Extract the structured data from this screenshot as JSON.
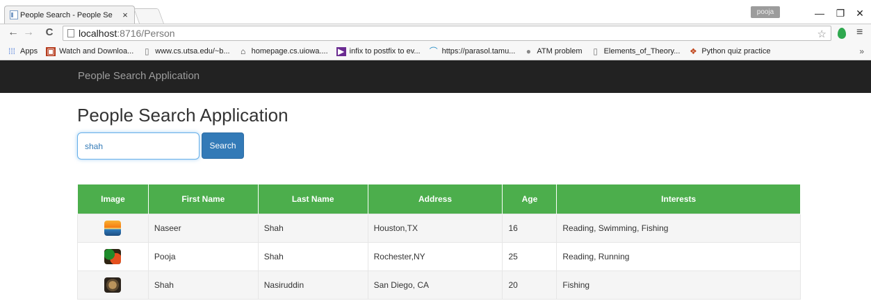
{
  "browser": {
    "tab_title": "People Search - People Se",
    "tab_close": "×",
    "profile": "pooja",
    "url_host": "localhost",
    "url_path": ":8716/Person",
    "bookmarks": [
      {
        "label": "Apps",
        "icon": "apps-grid-icon"
      },
      {
        "label": "Watch and Downloa...",
        "icon": "movie-icon"
      },
      {
        "label": "www.cs.utsa.edu/~b...",
        "icon": "page-icon"
      },
      {
        "label": "homepage.cs.uiowa....",
        "icon": "building-icon"
      },
      {
        "label": "infix to postfix to ev...",
        "icon": "visual-studio-icon"
      },
      {
        "label": "https://parasol.tamu...",
        "icon": "arc-icon"
      },
      {
        "label": "ATM problem",
        "icon": "globe-icon"
      },
      {
        "label": "Elements_of_Theory...",
        "icon": "page-icon"
      },
      {
        "label": "Python quiz practice",
        "icon": "leaf-icon"
      }
    ],
    "bookmarks_more": "»"
  },
  "navbar": {
    "brand": "People Search Application"
  },
  "main": {
    "title": "People Search Application",
    "search_value": "shah",
    "search_button": "Search"
  },
  "table": {
    "headers": [
      "Image",
      "First Name",
      "Last Name",
      "Address",
      "Age",
      "Interests"
    ],
    "rows": [
      {
        "image": "sunset",
        "first": "Naseer",
        "last": "Shah",
        "address": "Houston,TX",
        "age": "16",
        "interests": "Reading, Swimming, Fishing"
      },
      {
        "image": "pepper",
        "first": "Pooja",
        "last": "Shah",
        "address": "Rochester,NY",
        "age": "25",
        "interests": "Reading, Running"
      },
      {
        "image": "lion",
        "first": "Shah",
        "last": "Nasiruddin",
        "address": "San Diego, CA",
        "age": "20",
        "interests": "Fishing"
      }
    ]
  },
  "colors": {
    "navbar": "#222222",
    "table_header": "#4cae4c",
    "button": "#337ab7"
  }
}
